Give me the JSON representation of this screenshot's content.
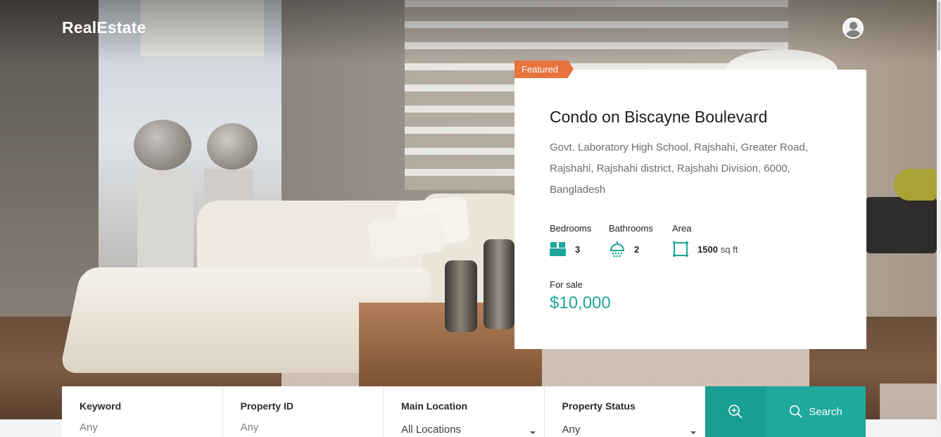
{
  "header": {
    "logo": "RealEstate",
    "avatar_icon": "user-avatar-icon"
  },
  "featured": {
    "badge": "Featured",
    "title": "Condo on Biscayne Boulevard",
    "address": "Govt. Laboratory High School, Rajshahi, Greater Road, Rajshahi, Rajshahi district, Rajshahi Division, 6000, Bangladesh",
    "features": {
      "bedrooms": {
        "label": "Bedrooms",
        "value": "3",
        "icon": "bed-icon"
      },
      "bathrooms": {
        "label": "Bathrooms",
        "value": "2",
        "icon": "shower-icon"
      },
      "area": {
        "label": "Area",
        "value": "1500",
        "unit": "sq ft",
        "icon": "area-icon"
      }
    },
    "status": "For sale",
    "price": "$10,000"
  },
  "search": {
    "keyword": {
      "label": "Keyword",
      "value": "Any"
    },
    "property_id": {
      "label": "Property ID",
      "value": "Any"
    },
    "main_location": {
      "label": "Main Location",
      "value": "All Locations"
    },
    "property_status": {
      "label": "Property Status",
      "value": "Any"
    },
    "search_label": "Search"
  },
  "colors": {
    "accent": "#1fa59a",
    "badge": "#e8743d"
  }
}
